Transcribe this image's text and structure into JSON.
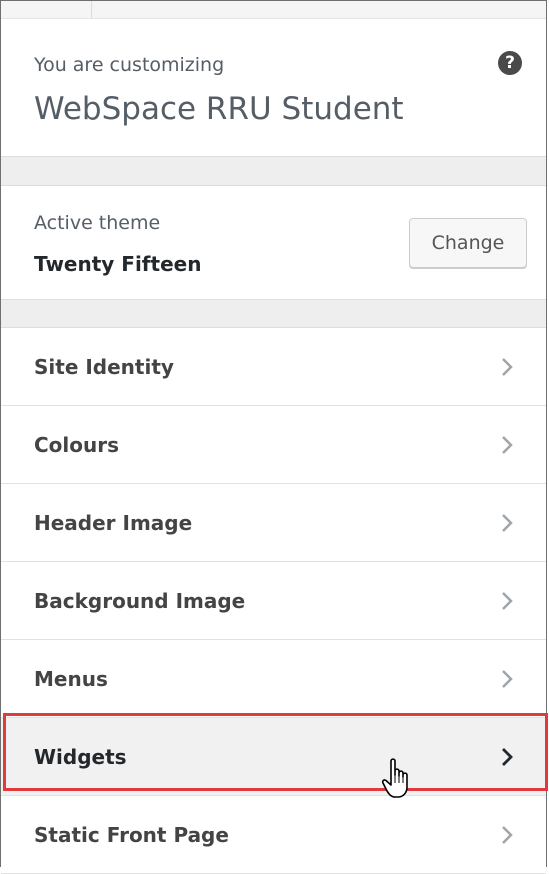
{
  "header": {
    "customizing_label": "You are customizing",
    "site_title": "WebSpace RRU Student",
    "help_icon": "help-icon",
    "help_glyph": "?"
  },
  "theme": {
    "label": "Active theme",
    "name": "Twenty Fifteen",
    "change_label": "Change"
  },
  "menu": {
    "items": [
      {
        "label": "Site Identity",
        "icon": "chevron-right-icon"
      },
      {
        "label": "Colours",
        "icon": "chevron-right-icon"
      },
      {
        "label": "Header Image",
        "icon": "chevron-right-icon"
      },
      {
        "label": "Background Image",
        "icon": "chevron-right-icon"
      },
      {
        "label": "Menus",
        "icon": "chevron-right-icon"
      },
      {
        "label": "Widgets",
        "icon": "chevron-right-icon",
        "highlighted": true,
        "highlight_color": "#e0393e"
      },
      {
        "label": "Static Front Page",
        "icon": "chevron-right-icon"
      }
    ]
  },
  "colors": {
    "panel_background": "#eeeeee",
    "section_background": "#ffffff",
    "highlight_border": "#e0393e",
    "text_muted": "#555d66",
    "text_dark": "#23282d"
  },
  "cursor": "hand-pointer-icon"
}
